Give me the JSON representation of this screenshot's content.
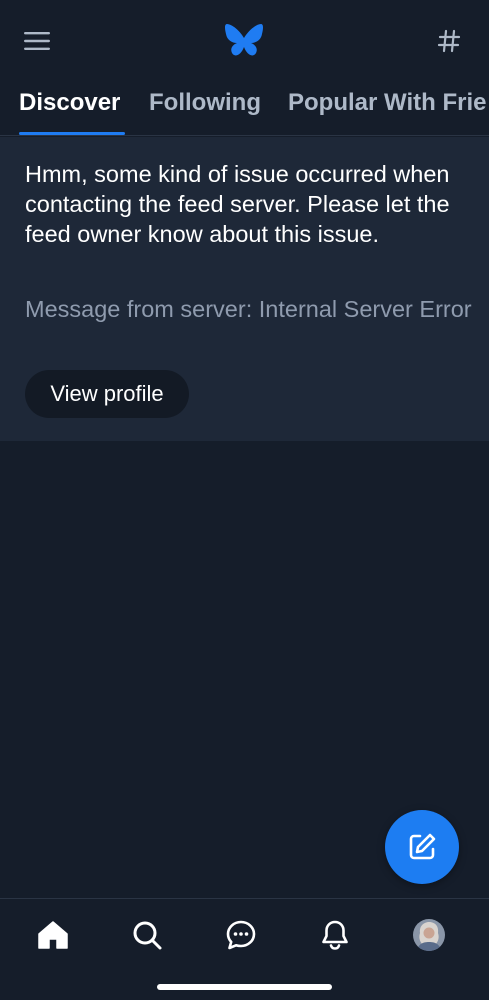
{
  "header": {
    "menu_icon": "hamburger-menu-icon",
    "logo_icon": "butterfly-logo-icon",
    "hash_icon": "hashtag-icon",
    "accent_color": "#1f7cf2"
  },
  "tabs": [
    {
      "label": "Discover",
      "active": true
    },
    {
      "label": "Following",
      "active": false
    },
    {
      "label": "Popular With Frie",
      "active": false
    }
  ],
  "error": {
    "message": "Hmm, some kind of issue occurred when contacting the feed server. Please let the feed owner know about this issue.",
    "server_message": "Message from server: Internal Server Error",
    "button_label": "View profile"
  },
  "fab": {
    "icon": "compose-icon",
    "color": "#1d7df2"
  },
  "bottom_nav": [
    {
      "icon": "home-icon"
    },
    {
      "icon": "search-icon"
    },
    {
      "icon": "chat-icon"
    },
    {
      "icon": "bell-icon"
    },
    {
      "icon": "avatar"
    }
  ]
}
